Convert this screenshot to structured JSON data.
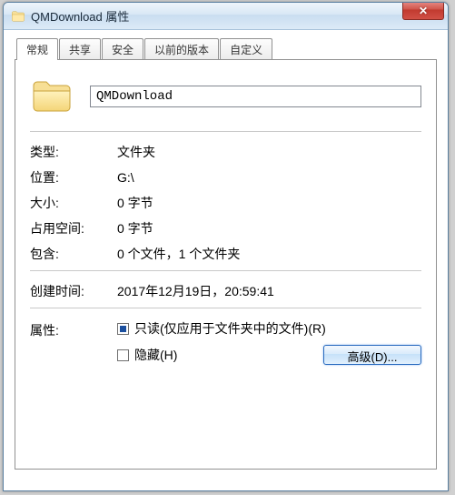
{
  "window": {
    "title": "QMDownload 属性"
  },
  "tabs": {
    "general": "常规",
    "sharing": "共享",
    "security": "安全",
    "previous": "以前的版本",
    "customize": "自定义"
  },
  "name_field": "QMDownload",
  "labels": {
    "type": "类型:",
    "location": "位置:",
    "size": "大小:",
    "size_on_disk": "占用空间:",
    "contains": "包含:",
    "created": "创建时间:",
    "attributes": "属性:"
  },
  "values": {
    "type": "文件夹",
    "location": "G:\\",
    "size": "0 字节",
    "size_on_disk": "0 字节",
    "contains": "0 个文件，1 个文件夹",
    "created": "2017年12月19日，20:59:41"
  },
  "attributes": {
    "readonly_label": "只读(仅应用于文件夹中的文件)(R)",
    "hidden_label": "隐藏(H)",
    "advanced_button": "高级(D)..."
  }
}
